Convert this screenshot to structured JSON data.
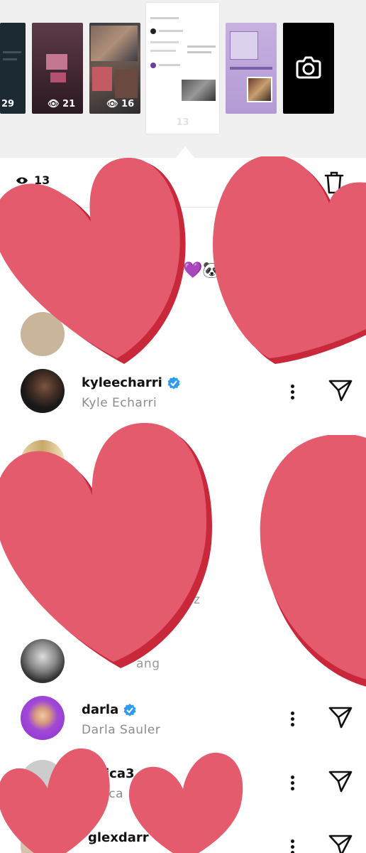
{
  "story_strip": {
    "thumbnails": [
      {
        "views": "29"
      },
      {
        "views": "21"
      },
      {
        "views": "16"
      },
      {
        "views": "13",
        "selected": true
      },
      {
        "views": ""
      },
      {
        "views": "",
        "camera": true
      }
    ]
  },
  "header": {
    "views_count": "13",
    "eye_icon": "eye-icon",
    "trash_icon": "trash-icon"
  },
  "sticker_emoji": "💜🐼",
  "viewers": [
    {
      "username": "kyleecharri",
      "full_name": "Kyle Echarri",
      "verified": true
    },
    {
      "username": "",
      "full_name": "",
      "partial_tail": "ez",
      "verified": false
    },
    {
      "username": "",
      "full_name": "",
      "partial_tail": "ang",
      "verified": false
    },
    {
      "username": "darla",
      "full_name": "Darla Sauler",
      "verified": true
    },
    {
      "username": "ica3",
      "full_name": "ica",
      "verified": false
    },
    {
      "username": "glexdarr",
      "full_name": "",
      "verified": false
    }
  ],
  "colors": {
    "heart": "#e55b6e",
    "heart_shadow": "#c9283b",
    "verified": "#2f9bf0",
    "strip_bg": "#f0f0f0",
    "secondary_text": "#8c8c8c"
  }
}
